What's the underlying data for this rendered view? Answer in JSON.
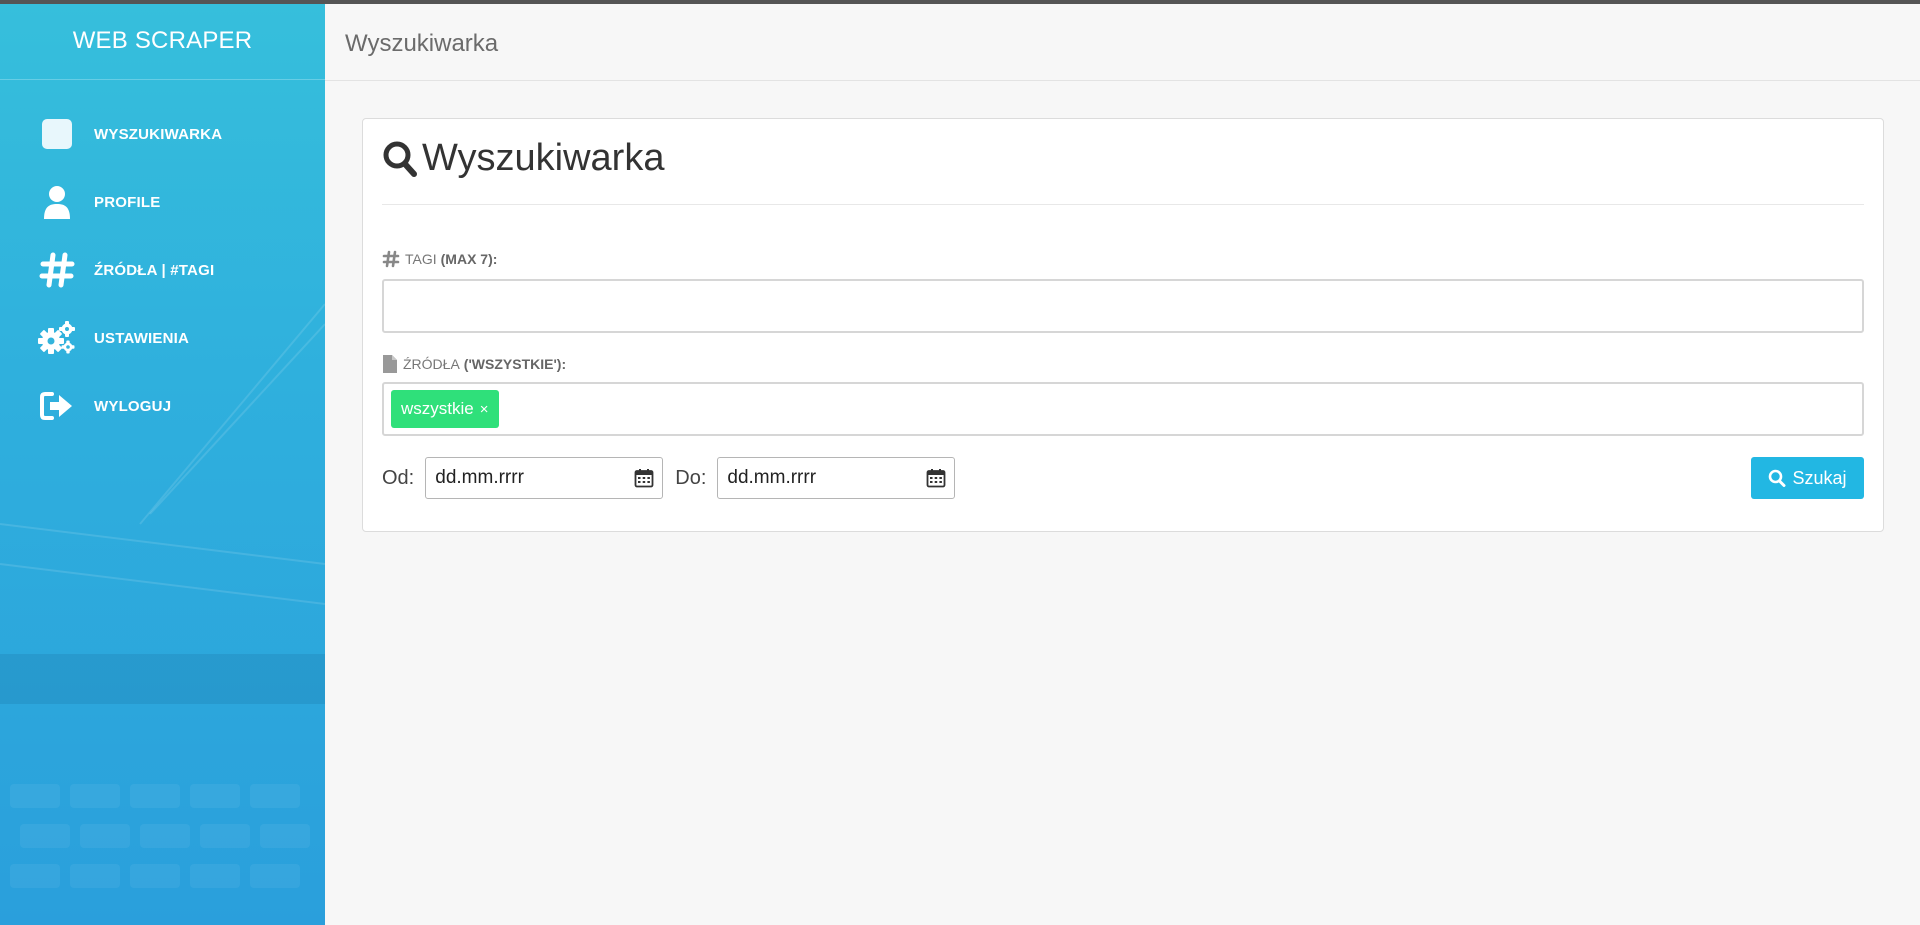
{
  "app": {
    "brand": "WEB SCRAPER"
  },
  "sidebar": {
    "items": [
      {
        "label": "WYSZUKIWARKA",
        "icon": "square-icon"
      },
      {
        "label": "PROFILE",
        "icon": "user-icon"
      },
      {
        "label": "ŹRÓDŁA | #TAGI",
        "icon": "hashtag-icon"
      },
      {
        "label": "USTAWIENIA",
        "icon": "gears-icon"
      },
      {
        "label": "WYLOGUJ",
        "icon": "sign-out-icon"
      }
    ]
  },
  "header": {
    "title": "Wyszukiwarka"
  },
  "search_card": {
    "title": "Wyszukiwarka",
    "tags_label": "TAGI",
    "tags_hint": "(MAX 7):",
    "tags_value": "",
    "sources_label": "ŹRÓDŁA",
    "sources_hint": "('WSZYSTKIE'):",
    "source_chips": [
      "wszystkie"
    ],
    "chip_remove": "×",
    "from_label": "Od:",
    "from_placeholder": "dd.mm.rrrr",
    "to_label": "Do:",
    "to_placeholder": "dd.mm.rrrr",
    "search_button": "Szukaj"
  },
  "colors": {
    "sidebar": "#2fb0dd",
    "chip": "#2fe07a",
    "button": "#22b7e3"
  }
}
